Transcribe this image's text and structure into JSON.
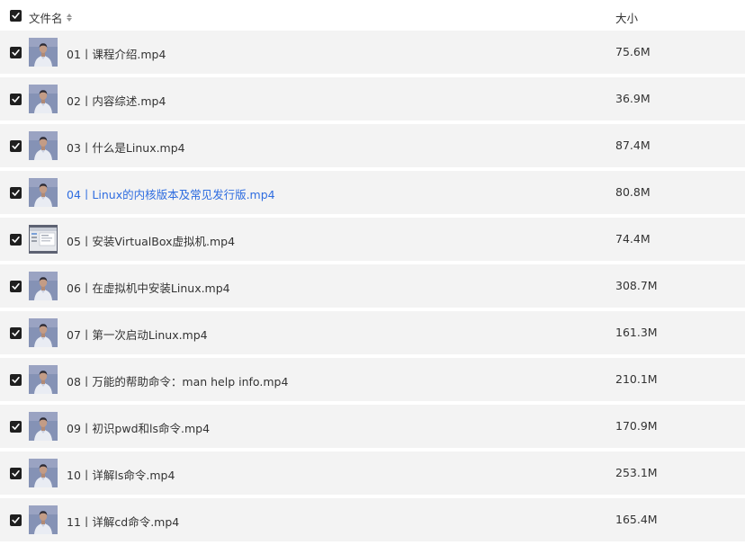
{
  "header": {
    "name_label": "文件名",
    "size_label": "大小",
    "select_all_checked": true,
    "sort_icon": "sort-icon"
  },
  "files": [
    {
      "name": "01丨课程介绍.mp4",
      "size": "75.6M",
      "thumb": "person",
      "checked": true
    },
    {
      "name": "02丨内容综述.mp4",
      "size": "36.9M",
      "thumb": "person",
      "checked": true
    },
    {
      "name": "03丨什么是Linux.mp4",
      "size": "87.4M",
      "thumb": "person",
      "checked": true
    },
    {
      "name": "04丨Linux的内核版本及常见发行版.mp4",
      "size": "80.8M",
      "thumb": "person",
      "checked": true,
      "active": true
    },
    {
      "name": "05丨安装VirtualBox虚拟机.mp4",
      "size": "74.4M",
      "thumb": "screen",
      "checked": true
    },
    {
      "name": "06丨在虚拟机中安装Linux.mp4",
      "size": "308.7M",
      "thumb": "person",
      "checked": true
    },
    {
      "name": "07丨第一次启动Linux.mp4",
      "size": "161.3M",
      "thumb": "person",
      "checked": true
    },
    {
      "name": "08丨万能的帮助命令：man help info.mp4",
      "size": "210.1M",
      "thumb": "person",
      "checked": true
    },
    {
      "name": "09丨初识pwd和ls命令.mp4",
      "size": "170.9M",
      "thumb": "person",
      "checked": true
    },
    {
      "name": "10丨详解ls命令.mp4",
      "size": "253.1M",
      "thumb": "person",
      "checked": true
    },
    {
      "name": "11丨详解cd命令.mp4",
      "size": "165.4M",
      "thumb": "person",
      "checked": true
    }
  ],
  "colors": {
    "row_bg": "#f3f3f3",
    "active_text": "#2f6de0",
    "checkbox": "#1f1f1f"
  }
}
